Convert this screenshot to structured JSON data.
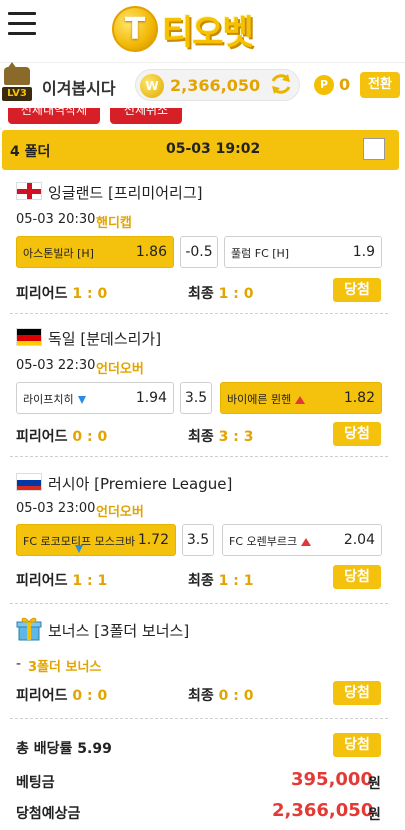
{
  "header": {
    "logo_coin_letter": "T",
    "logo_text": "티오벳"
  },
  "user": {
    "level": "LV3",
    "name": "이겨봅시다",
    "balance": "2,366,050",
    "points": "0",
    "convert_label": "전환"
  },
  "tabs": {
    "left_label": "전체내역삭제",
    "right_label": "전체취소"
  },
  "folder": {
    "count_label": "4 폴더",
    "datetime": "05-03 19:02"
  },
  "bets": [
    {
      "league": "잉글랜드 [프리미어리그]",
      "datetime": "05-03 20:30",
      "market": "핸디캡",
      "home_name": "아스톤빌라 [H]",
      "home_odd": "1.86",
      "line": "-0.5",
      "away_name": "풀럼 FC [H]",
      "away_odd": "1.9",
      "half_label": "피리어드",
      "half_score": "1 : 0",
      "final_label": "최종",
      "final_score": "1 : 0",
      "result": "당첨"
    },
    {
      "league": "독일 [분데스리가]",
      "datetime": "05-03 22:30",
      "market": "언더오버",
      "home_name": "라이프치히",
      "home_odd": "1.94",
      "line": "3.5",
      "away_name": "바이에른 뮌헨",
      "away_odd": "1.82",
      "half_label": "피리어드",
      "half_score": "0 : 0",
      "final_label": "최종",
      "final_score": "3 : 3",
      "result": "당첨"
    },
    {
      "league": "러시아 [Premiere League]",
      "datetime": "05-03 23:00",
      "market": "언더오버",
      "home_name": "FC 로코모티프 모스크바",
      "home_odd": "1.72",
      "line": "3.5",
      "away_name": "FC 오렌부르크",
      "away_odd": "2.04",
      "half_label": "피리어드",
      "half_score": "1 : 1",
      "final_label": "최종",
      "final_score": "1 : 1",
      "result": "당첨"
    }
  ],
  "bonus": {
    "title": "보너스 [3폴더 보너스]",
    "item": "3폴더 보너스",
    "half_label": "피리어드",
    "half_score": "0 : 0",
    "final_label": "최종",
    "final_score": "0 : 0",
    "result": "당첨"
  },
  "summary": {
    "total_odds_label": "총 배당률 5.99",
    "total_result": "당첨",
    "stake_label": "베팅금",
    "stake": "395,000",
    "payout_label": "당첨예상금",
    "payout": "2,366,050",
    "currency": "원"
  },
  "colors": {
    "accent_yellow": "#f4c20d",
    "accent_red": "#e33a35",
    "text_gold": "#e2a400"
  }
}
